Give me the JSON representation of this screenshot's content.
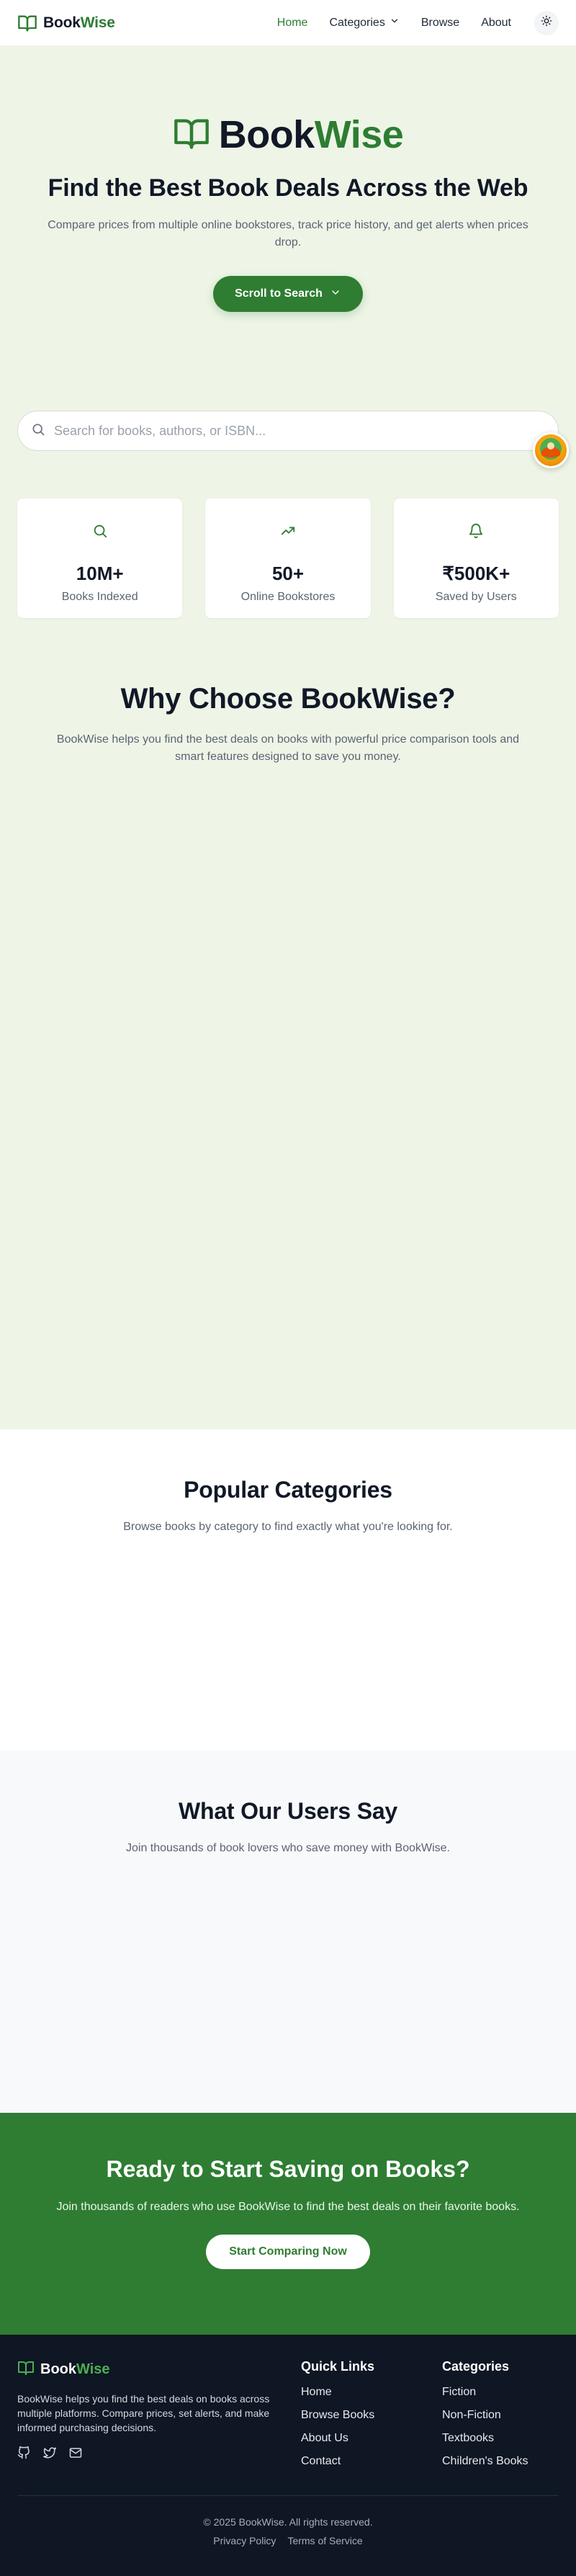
{
  "nav": {
    "brand_a": "Book",
    "brand_b": "Wise",
    "links": [
      "Home",
      "Categories",
      "Browse",
      "About"
    ]
  },
  "hero": {
    "logo_a": "Book",
    "logo_b": "Wise",
    "title": "Find the Best Book Deals Across the Web",
    "subtitle": "Compare prices from multiple online bookstores, track price history, and get alerts when prices drop.",
    "scroll_button": "Scroll to Search"
  },
  "search": {
    "placeholder": "Search for books, authors, or ISBN...",
    "value": ""
  },
  "stats": [
    {
      "icon": "search-icon",
      "value": "10M+",
      "label": "Books Indexed"
    },
    {
      "icon": "trending-up-icon",
      "value": "50+",
      "label": "Online Bookstores"
    },
    {
      "icon": "bell-icon",
      "value": "₹500K+",
      "label": "Saved by Users"
    }
  ],
  "why": {
    "title": "Why Choose BookWise?",
    "subtitle": "BookWise helps you find the best deals on books with powerful price comparison tools and smart features designed to save you money."
  },
  "categories": {
    "title": "Popular Categories",
    "subtitle": "Browse books by category to find exactly what you're looking for."
  },
  "testimonials": {
    "title": "What Our Users Say",
    "subtitle": "Join thousands of book lovers who save money with BookWise."
  },
  "cta": {
    "title": "Ready to Start Saving on Books?",
    "subtitle": "Join thousands of readers who use BookWise to find the best deals on their favorite books.",
    "button": "Start Comparing Now"
  },
  "footer": {
    "brand_a": "Book",
    "brand_b": "Wise",
    "description": "BookWise helps you find the best deals on books across multiple platforms. Compare prices, set alerts, and make informed purchasing decisions.",
    "socials": [
      "github-icon",
      "twitter-icon",
      "mail-icon"
    ],
    "quick_links_heading": "Quick Links",
    "quick_links": [
      "Home",
      "Browse Books",
      "About Us",
      "Contact"
    ],
    "categories_heading": "Categories",
    "categories": [
      "Fiction",
      "Non-Fiction",
      "Textbooks",
      "Children's Books"
    ],
    "copyright": "© 2025 BookWise. All rights reserved.",
    "legal": [
      "Privacy Policy",
      "Terms of Service"
    ]
  },
  "colors": {
    "accent": "#2e7d32",
    "hero_bg": "#eef5e7",
    "footer_bg": "#0f1624",
    "testimonials_bg": "#f8f9fa"
  }
}
